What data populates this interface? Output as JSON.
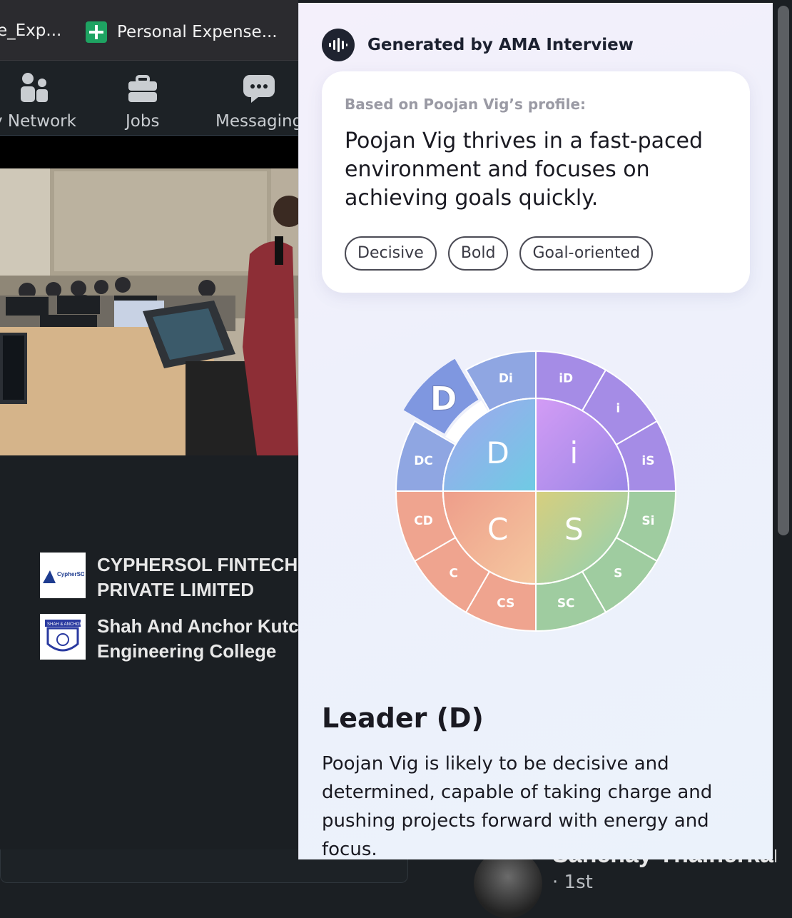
{
  "bookmarks": [
    {
      "label": "e_Exp..."
    },
    {
      "label": "Personal Expense..."
    }
  ],
  "nav": {
    "network": "y Network",
    "jobs": "Jobs",
    "messaging": "Messaging"
  },
  "companies": [
    {
      "name_line1": "CYPHERSOL FINTECH",
      "name_line2": "PRIVATE LIMITED",
      "logo_text": "CypherSOL"
    },
    {
      "name_line1": "Shah And Anchor Kutchhi",
      "name_line2": "Engineering College",
      "logo_text": "SHAH & ANCHOR"
    }
  ],
  "person": {
    "name": "Sanchay Thalnerkar",
    "degree": "· 1st"
  },
  "panel": {
    "generated_by": "Generated by AMA Interview",
    "based_on": "Based on Poojan Vig’s profile:",
    "summary": "Poojan Vig thrives in a fast-paced environment and focuses on achieving goals quickly.",
    "tags": [
      "Decisive",
      "Bold",
      "Goal-oriented"
    ],
    "disc": {
      "highlighted": "D",
      "quadrants": [
        "D",
        "i",
        "S",
        "C"
      ],
      "segments": [
        "Di",
        "iD",
        "i",
        "iS",
        "Si",
        "S",
        "SC",
        "CS",
        "C",
        "CD",
        "DC",
        "D"
      ],
      "colors": {
        "D": "#8ea6e6",
        "i": "#a98ae6",
        "S": "#9ccc9e",
        "C": "#f0a08c"
      }
    },
    "style_title": "Leader (D)",
    "style_description": "Poojan Vig is likely to be decisive and determined, capable of taking charge and pushing projects forward with energy and focus."
  }
}
